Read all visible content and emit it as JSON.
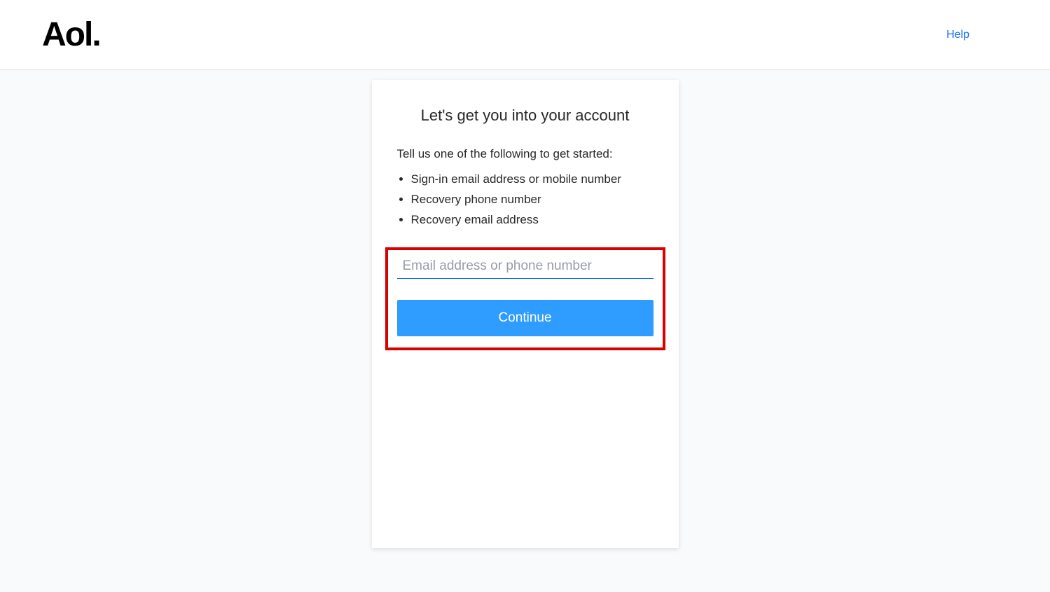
{
  "header": {
    "logo_text": "Aol.",
    "help_label": "Help"
  },
  "card": {
    "title": "Let's get you into your account",
    "instruction": "Tell us one of the following to get started:",
    "options": [
      "Sign-in email address or mobile number",
      "Recovery phone number",
      "Recovery email address"
    ],
    "input_placeholder": "Email address or phone number",
    "input_value": "",
    "continue_label": "Continue"
  }
}
